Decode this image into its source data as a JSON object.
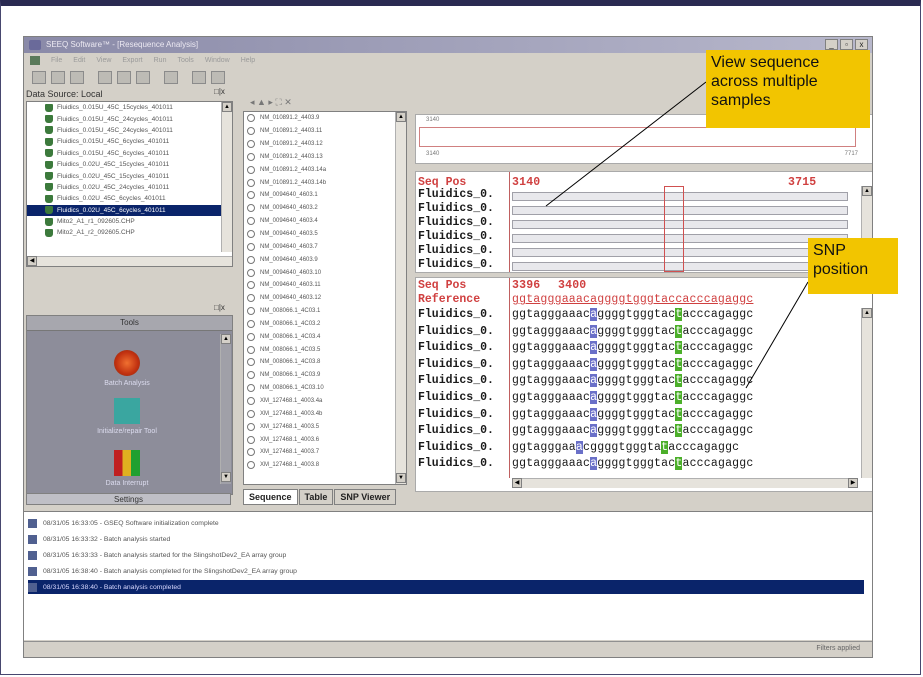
{
  "window": {
    "title": "SEEQ Software™ - [Resequence Analysis]",
    "controls": [
      "_",
      "▫",
      "x"
    ]
  },
  "menu": [
    "File",
    "Edit",
    "View",
    "Export",
    "Run",
    "Tools",
    "Window",
    "Help"
  ],
  "data_source": {
    "header": "Data Source: Local",
    "items": [
      "Fluidics_0.015U_45C_15cycles_401011",
      "Fluidics_0.015U_45C_24cycles_401011",
      "Fluidics_0.015U_45C_24cycles_401011",
      "Fluidics_0.015U_45C_6cycles_401011",
      "Fluidics_0.015U_45C_6cycles_401011",
      "Fluidics_0.02U_45C_15cycles_401011",
      "Fluidics_0.02U_45C_15cycles_401011",
      "Fluidics_0.02U_45C_24cycles_401011",
      "Fluidics_0.02U_45C_6cycles_401011",
      "Fluidics_0.02U_45C_6cycles_401011",
      "Mito2_A1_r1_092605.CHP",
      "Mito2_A1_r2_092605.CHP"
    ],
    "selected_index": 9
  },
  "tools": {
    "title": "Tools",
    "items": [
      "Batch Analysis",
      "Initialize/repair Tool",
      "Data Interrupt"
    ],
    "settings_label": "Settings"
  },
  "samples": [
    "NM_010891.2_4403.9",
    "NM_010891.2_4403.11",
    "NM_010891.2_4403.12",
    "NM_010891.2_4403.13",
    "NM_010891.2_4403.14a",
    "NM_010891.2_4403.14b",
    "NM_0094640_4603.1",
    "NM_0094640_4603.2",
    "NM_0094640_4603.4",
    "NM_0094640_4603.5",
    "NM_0094640_4603.7",
    "NM_0094640_4603.9",
    "NM_0094640_4603.10",
    "NM_0094640_4603.11",
    "NM_0094640_4603.12",
    "NM_008066.1_4C03.1",
    "NM_008066.1_4C03.2",
    "NM_008066.1_4C03.4",
    "NM_008066.1_4C03.5",
    "NM_008066.1_4C03.8",
    "NM_008066.1_4C03.9",
    "NM_008066.1_4C03.10",
    "XM_127468.1_4003.4a",
    "XM_127468.1_4003.4b",
    "XM_127468.1_4003.5",
    "XM_127468.1_4003.6",
    "XM_127468.1_4003.7",
    "XM_127468.1_4003.8"
  ],
  "tabs": [
    "Sequence",
    "Table",
    "SNP Viewer"
  ],
  "overview": {
    "start": "3140",
    "end": "7717"
  },
  "aligned_view": {
    "seq_pos_label": "Seq Pos",
    "start": "3140",
    "end": "3715",
    "rows": [
      "Fluidics_0.",
      "Fluidics_0.",
      "Fluidics_0.",
      "Fluidics_0.",
      "Fluidics_0.",
      "Fluidics_0."
    ]
  },
  "base_view": {
    "seq_pos_label": "Seq Pos",
    "reference_label": "Reference",
    "pos_a": "3396",
    "pos_b": "3400",
    "pos_c": "3",
    "reference_seq": "ggtagggaaacaggggtgggtaccacccagaggc",
    "rows": [
      {
        "name": "Fluidics_0.",
        "a": "ggtagggaaac",
        "b": "a",
        "c": "ggggtgggtac",
        "d": "t",
        "e": "acccagaggc"
      },
      {
        "name": "Fluidics_0.",
        "a": "ggtagggaaac",
        "b": "a",
        "c": "ggggtgggtac",
        "d": "t",
        "e": "acccagaggc"
      },
      {
        "name": "Fluidics_0.",
        "a": "ggtagggaaac",
        "b": "a",
        "c": "ggggtgggtac",
        "d": "t",
        "e": "acccagaggc"
      },
      {
        "name": "Fluidics_0.",
        "a": "ggtagggaaac",
        "b": "a",
        "c": "ggggtgggtac",
        "d": "t",
        "e": "acccagaggc"
      },
      {
        "name": "Fluidics_0.",
        "a": "ggtagggaaac",
        "b": "a",
        "c": "ggggtgggtac",
        "d": "t",
        "e": "acccagaggc"
      },
      {
        "name": "Fluidics_0.",
        "a": "ggtagggaaac",
        "b": "a",
        "c": "ggggtgggtac",
        "d": "t",
        "e": "acccagaggc"
      },
      {
        "name": "Fluidics_0.",
        "a": "ggtagggaaac",
        "b": "a",
        "c": "ggggtgggtac",
        "d": "t",
        "e": "acccagaggc"
      },
      {
        "name": "Fluidics_0.",
        "a": "ggtagggaaac",
        "b": "a",
        "c": "ggggtgggtac",
        "d": "t",
        "e": "acccagaggc"
      },
      {
        "name": "Fluidics_0.",
        "a": "ggtagggaa",
        "b": "a",
        "c": "cggggtgggta",
        "d": "t",
        "e": "acccagaggc"
      },
      {
        "name": "Fluidics_0.",
        "a": "ggtagggaaac",
        "b": "a",
        "c": "ggggtgggtac",
        "d": "t",
        "e": "acccagaggc"
      }
    ]
  },
  "log": [
    "08/31/05 16:33:05 - GSEQ Software initialization complete",
    "08/31/05 16:33:32 - Batch analysis started",
    "08/31/05 16:33:33 - Batch analysis started for the SlingshotDev2_EA array group",
    "08/31/05 16:38:40 - Batch analysis completed for the SlingshotDev2_EA array group",
    "08/31/05 16:38:40 - Batch analysis completed"
  ],
  "status": "Filters applied",
  "annotations": {
    "view_sequence": "View sequence across multiple samples",
    "snp_position": "SNP position"
  },
  "colors": {
    "highlight_blue": "#6a70c8",
    "highlight_green": "#4caf2a",
    "callout": "#f2c500",
    "selection": "#0a246a"
  }
}
